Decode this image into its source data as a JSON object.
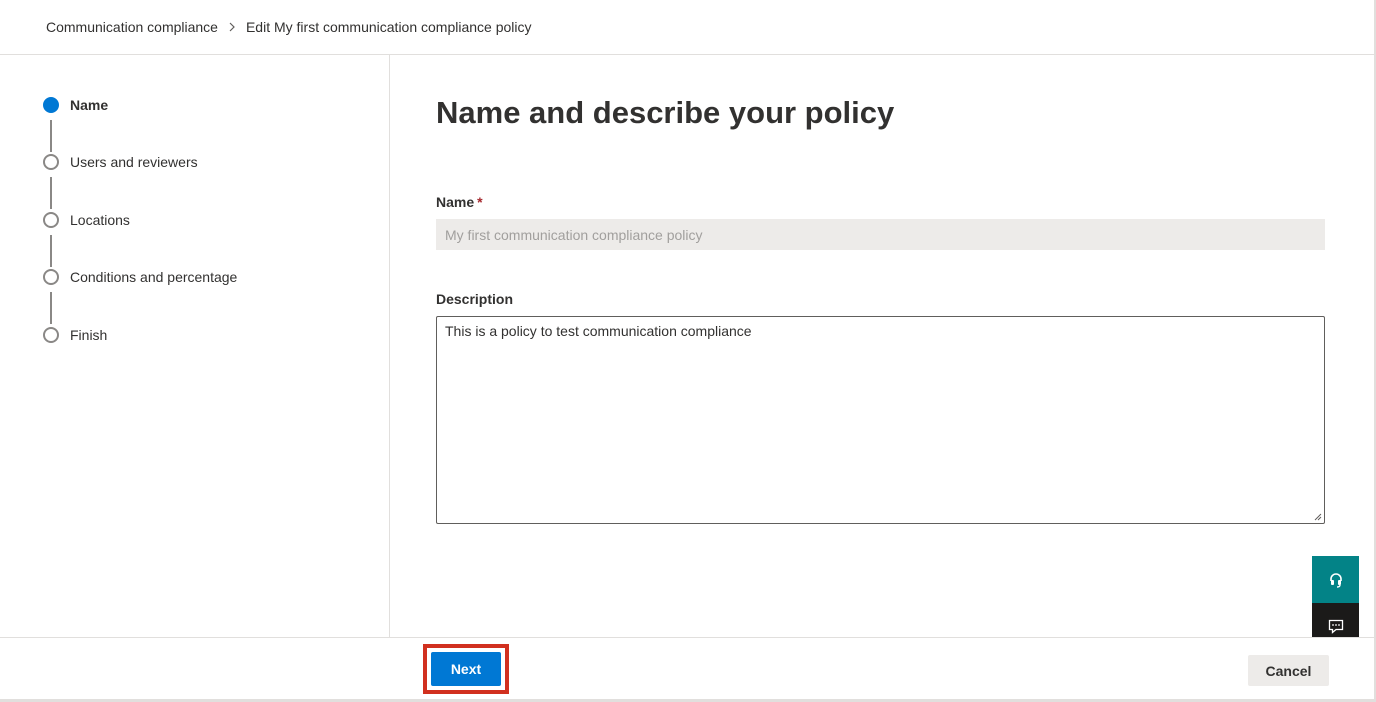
{
  "breadcrumb": {
    "parent": "Communication compliance",
    "separator": ">",
    "current": "Edit My first communication compliance policy"
  },
  "steps": [
    {
      "label": "Name",
      "active": true
    },
    {
      "label": "Users and reviewers",
      "active": false
    },
    {
      "label": "Locations",
      "active": false
    },
    {
      "label": "Conditions and percentage",
      "active": false
    },
    {
      "label": "Finish",
      "active": false
    }
  ],
  "main": {
    "title": "Name and describe your policy",
    "name_label": "Name",
    "required_marker": "*",
    "name_value": "My first communication compliance policy",
    "description_label": "Description",
    "description_value": "This is a policy to test communication compliance"
  },
  "floating": {
    "help_icon": "headset-icon",
    "feedback_icon": "feedback-icon"
  },
  "footer": {
    "next_label": "Next",
    "cancel_label": "Cancel"
  },
  "colors": {
    "accent": "#0078d4",
    "help_button": "#038387",
    "feedback_button": "#1b1a19",
    "highlight": "#d1301f"
  }
}
